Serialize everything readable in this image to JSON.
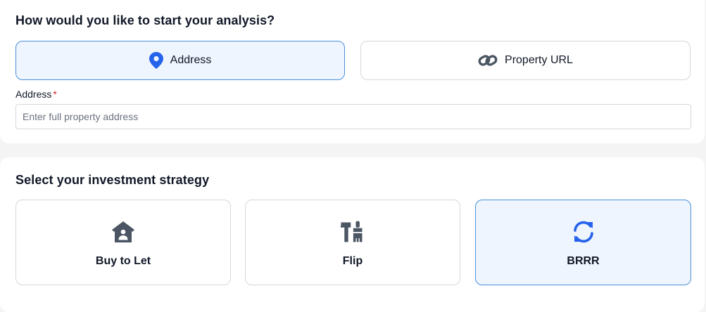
{
  "start_section": {
    "title": "How would you like to start your analysis?",
    "options": [
      {
        "label": "Address",
        "icon": "map-pin-icon",
        "selected": true
      },
      {
        "label": "Property URL",
        "icon": "link-icon",
        "selected": false
      }
    ],
    "address_field": {
      "label": "Address",
      "required_mark": "*",
      "value": "",
      "placeholder": "Enter full property address"
    }
  },
  "strategy_section": {
    "title": "Select your investment strategy",
    "options": [
      {
        "label": "Buy to Let",
        "icon": "house-user-icon",
        "selected": false
      },
      {
        "label": "Flip",
        "icon": "hammer-brush-icon",
        "selected": false
      },
      {
        "label": "BRRR",
        "icon": "refresh-icon",
        "selected": true
      }
    ]
  },
  "colors": {
    "accent": "#2563eb",
    "selected_bg": "#eef5fe",
    "selected_border": "#4a90d9",
    "icon_gray": "#4b5563",
    "required": "#dc2626"
  }
}
